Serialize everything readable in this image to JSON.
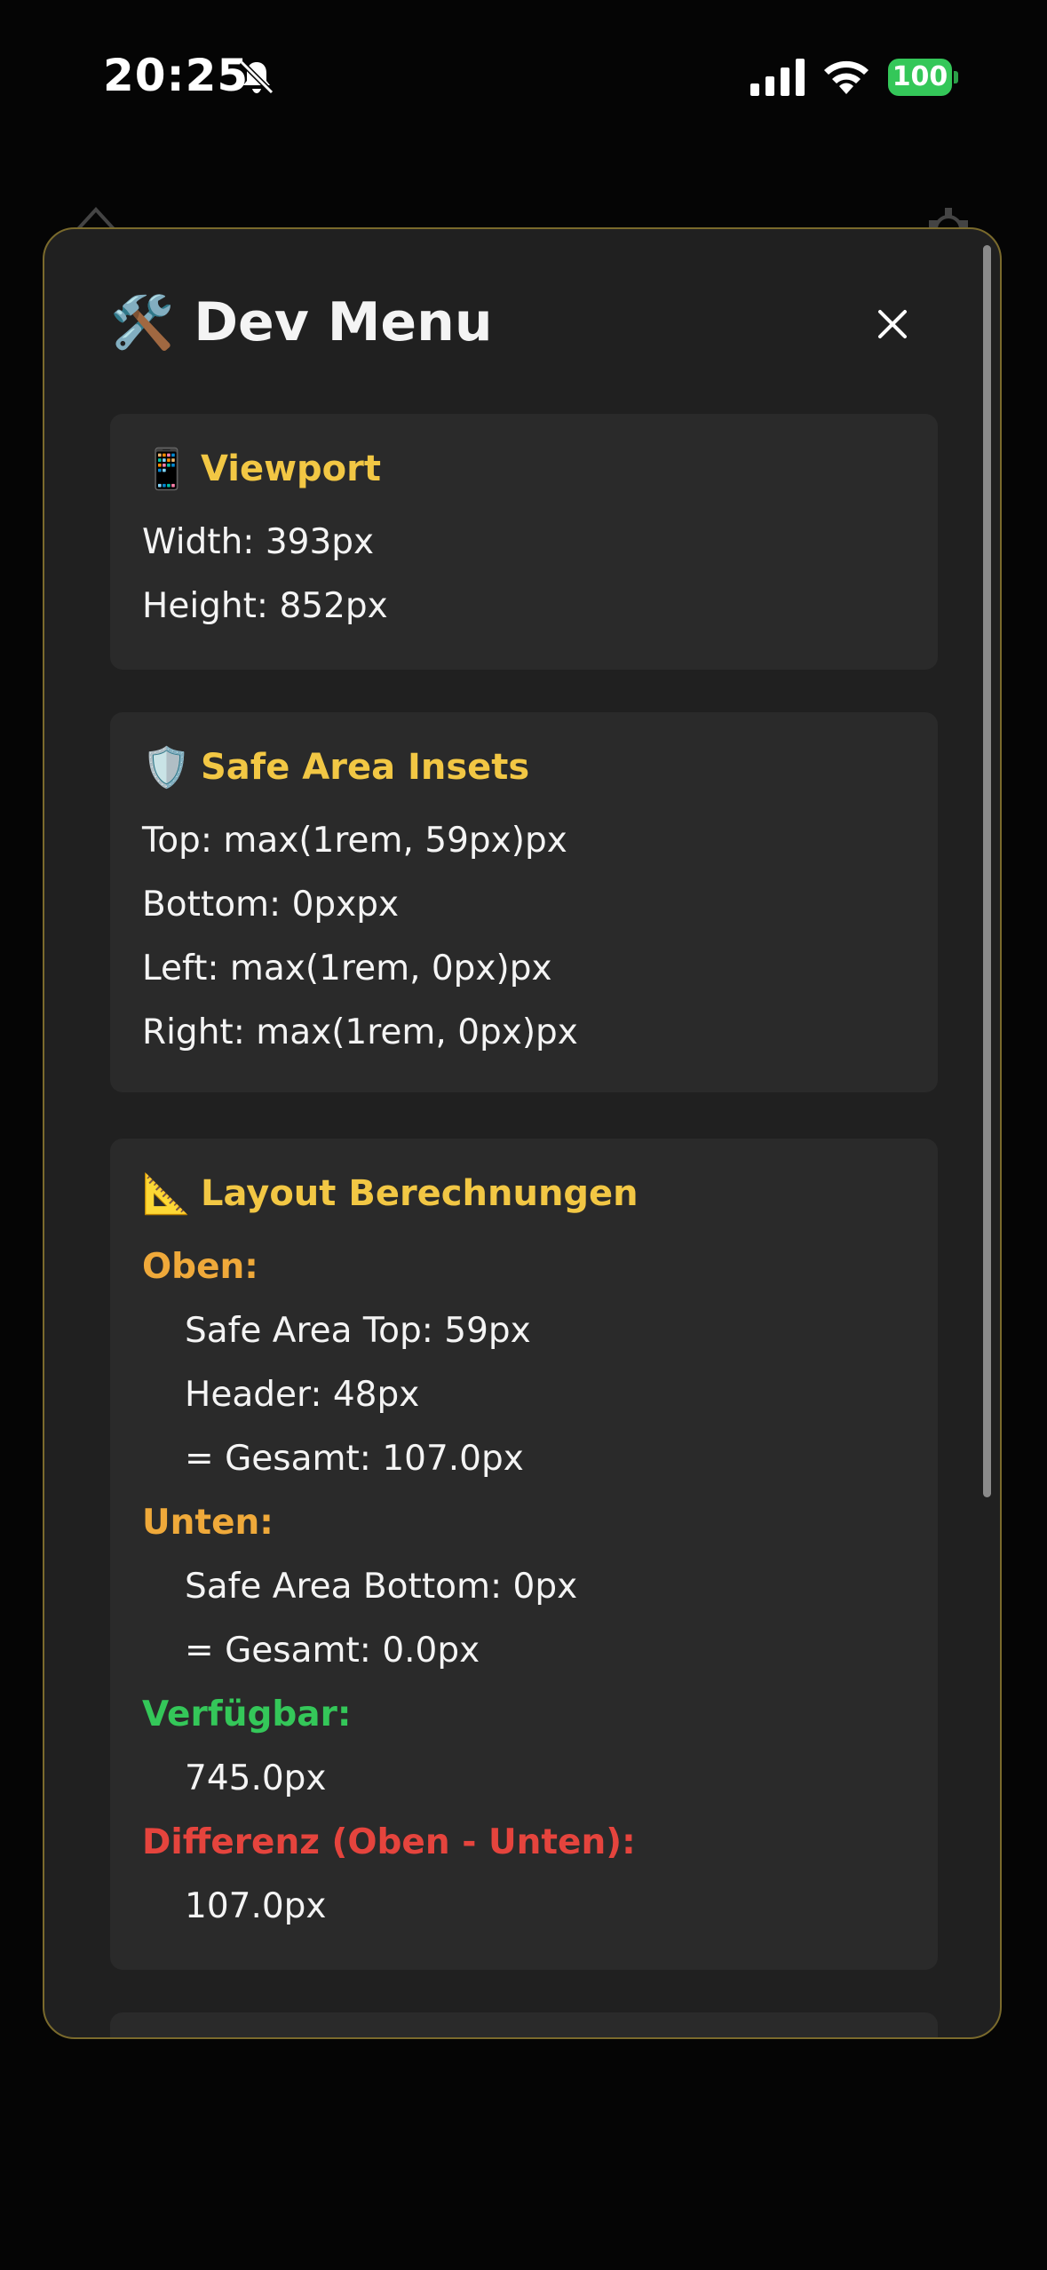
{
  "status_bar": {
    "time": "20:25",
    "battery": "100"
  },
  "modal": {
    "icon": "🛠️",
    "title": "Dev Menu",
    "viewport": {
      "icon": "📱",
      "title": "Viewport",
      "width": "Width: 393px",
      "height": "Height: 852px"
    },
    "safe_area": {
      "icon": "🛡️",
      "title": "Safe Area Insets",
      "top": "Top: max(1rem, 59px)px",
      "bottom": "Bottom: 0pxpx",
      "left": "Left: max(1rem, 0px)px",
      "right": "Right: max(1rem, 0px)px"
    },
    "layout": {
      "icon": "📐",
      "title": "Layout Berechnungen",
      "oben_label": "Oben:",
      "safe_top": "Safe Area Top: 59px",
      "header": "Header: 48px",
      "oben_total": "= Gesamt: 107.0px",
      "unten_label": "Unten:",
      "safe_bottom": "Safe Area Bottom: 0px",
      "unten_total": "= Gesamt: 0.0px",
      "verfuegbar_label": "Verfügbar:",
      "verfuegbar_value": "745.0px",
      "differenz_label": "Differenz (Oben - Unten):",
      "differenz_value": "107.0px"
    }
  },
  "colors": {
    "heading": "#f2c744",
    "orange": "#efa93a",
    "green": "#34c759",
    "red": "#e5443d",
    "border": "#7a6a2c"
  }
}
